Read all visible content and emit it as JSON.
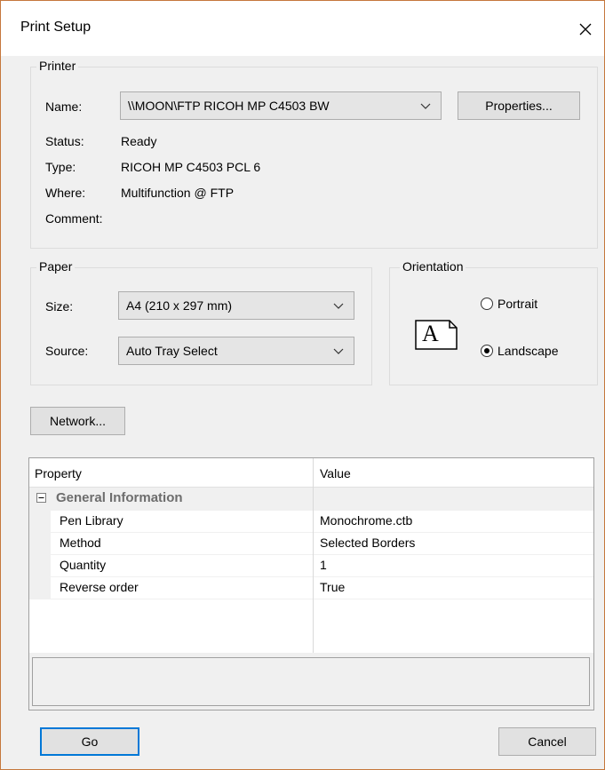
{
  "window": {
    "title": "Print Setup"
  },
  "printer": {
    "group_label": "Printer",
    "name_label": "Name:",
    "name_value": "\\\\MOON\\FTP RICOH MP C4503 BW",
    "properties_button": "Properties...",
    "status_label": "Status:",
    "status_value": "Ready",
    "type_label": "Type:",
    "type_value": "RICOH MP C4503 PCL 6",
    "where_label": "Where:",
    "where_value": "Multifunction @ FTP",
    "comment_label": "Comment:"
  },
  "paper": {
    "group_label": "Paper",
    "size_label": "Size:",
    "size_value": "A4 (210 x 297 mm)",
    "source_label": "Source:",
    "source_value": "Auto Tray Select"
  },
  "orientation": {
    "group_label": "Orientation",
    "icon_letter": "A",
    "portrait_label": "Portrait",
    "landscape_label": "Landscape",
    "selected": "Landscape"
  },
  "network_button": "Network...",
  "properties_grid": {
    "col_property": "Property",
    "col_value": "Value",
    "category": "General Information",
    "rows": [
      {
        "property": "Pen Library",
        "value": "Monochrome.ctb"
      },
      {
        "property": "Method",
        "value": "Selected Borders"
      },
      {
        "property": "Quantity",
        "value": "1"
      },
      {
        "property": "Reverse order",
        "value": "True"
      }
    ]
  },
  "footer": {
    "go_button": "Go",
    "cancel_button": "Cancel"
  },
  "colors": {
    "accent": "#0078d7",
    "border": "#adadad",
    "background": "#f0f0f0"
  },
  "icons": [
    "close-icon",
    "chevron-down-icon",
    "collapse-icon",
    "landscape-orientation-icon"
  ]
}
